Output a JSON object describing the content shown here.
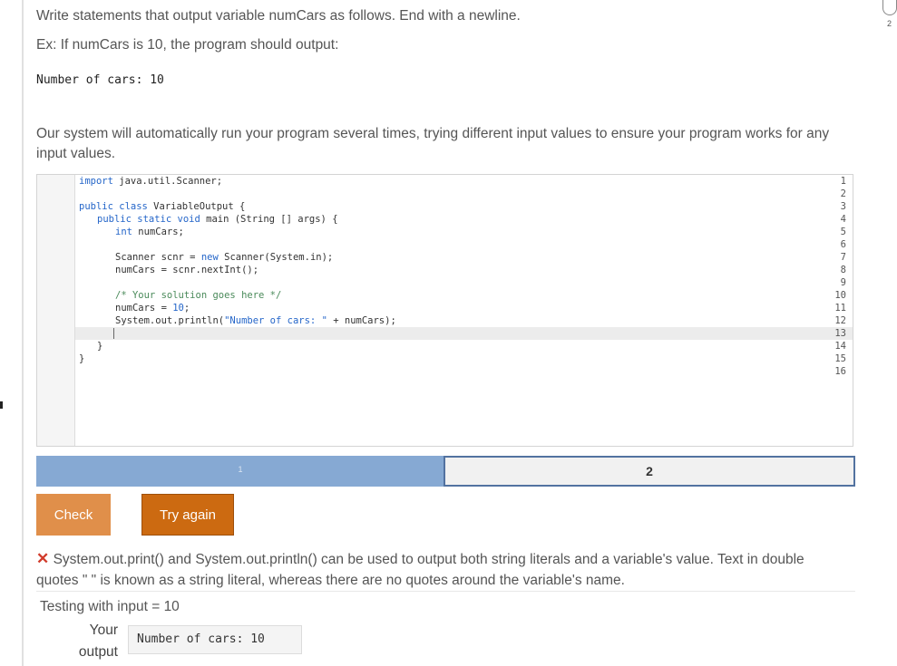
{
  "prompt": {
    "line1": "Write statements that output variable numCars as follows. End with a newline.",
    "line2": "Ex: If numCars is 10, the program should output:",
    "example_output": "Number of cars: 10",
    "line3": "Our system will automatically run your program several times, trying different input values to ensure your program works for any input values."
  },
  "editor": {
    "line_numbers": [
      "1",
      "2",
      "3",
      "4",
      "5",
      "6",
      "7",
      "8",
      "9",
      "10",
      "11",
      "12",
      "13",
      "14",
      "15",
      "16"
    ],
    "code": {
      "l1_kw": "import",
      "l1_rest": " java.util.Scanner;",
      "l3_kw": "public class",
      "l3_rest": " VariableOutput {",
      "l4_kw": "public static void",
      "l4_rest": " main (String [] args) {",
      "l5_kw": "int",
      "l5_rest": " numCars;",
      "l7_a": "Scanner scnr = ",
      "l7_kw": "new",
      "l7_b": " Scanner(System.in);",
      "l8": "numCars = scnr.nextInt();",
      "l10": "/* Your solution goes here */",
      "l11_a": "numCars = ",
      "l11_num": "10",
      "l11_b": ";",
      "l12_a": "System.out.println(",
      "l12_str": "\"Number of cars: \"",
      "l12_b": " + numCars);",
      "l14": "}",
      "l15": "}"
    }
  },
  "progress": {
    "segments": [
      {
        "label": "1",
        "state": "done"
      },
      {
        "label": "2",
        "state": "current"
      }
    ]
  },
  "buttons": {
    "check": "Check",
    "try_again": "Try again"
  },
  "feedback": {
    "icon": "x-icon",
    "message": "System.out.print() and System.out.println() can be used to output both string literals and a variable's value. Text in double quotes \" \" is known as a string literal, whereas there are no quotes around the variable's name."
  },
  "test": {
    "heading": "Testing with input = 10",
    "your_label_1": "Your",
    "your_label_2": "output",
    "your_output": "Number of cars: 10"
  },
  "side": {
    "right_number": "2"
  },
  "colors": {
    "check_button": "#e08f4a",
    "try_button": "#cc6a11",
    "progress_done": "#86a9d3",
    "progress_current_border": "#5272a0",
    "error_x": "#d13b2b"
  }
}
